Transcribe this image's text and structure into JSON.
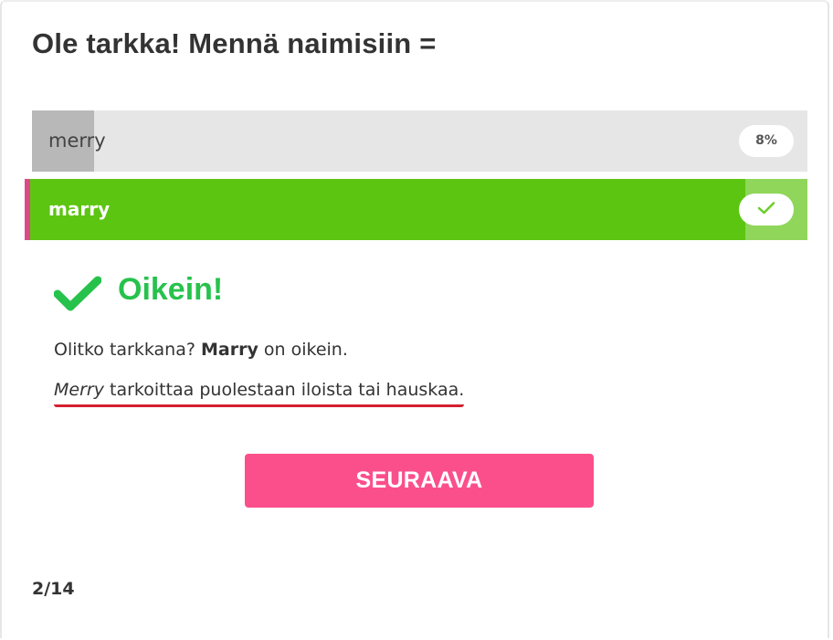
{
  "quiz": {
    "question": "Ole tarkka! Mennä naimisiin =",
    "options": [
      {
        "label": "merry",
        "percent": "8%",
        "fill_fraction": 0.08,
        "state": "wrong"
      },
      {
        "label": "marry",
        "icon": "check-icon",
        "fill_fraction": 0.92,
        "state": "correct"
      }
    ],
    "result": {
      "icon": "big-check-icon",
      "title": "Oikein!",
      "line1_prefix": "Olitko tarkkana? ",
      "line1_bold": "Marry",
      "line1_suffix": " on oikein.",
      "line2_italic": "Merry",
      "line2_rest": " tarkoittaa puolestaan iloista tai hauskaa."
    },
    "next_button": "SEURAAVA",
    "progress": "2/14"
  },
  "colors": {
    "correct_green": "#5cc511",
    "title_green": "#27c24c",
    "button_pink": "#fb4f8c",
    "option_grey": "#e6e6e6",
    "fill_grey": "#b8b8b8",
    "underline_red": "#d42030"
  }
}
